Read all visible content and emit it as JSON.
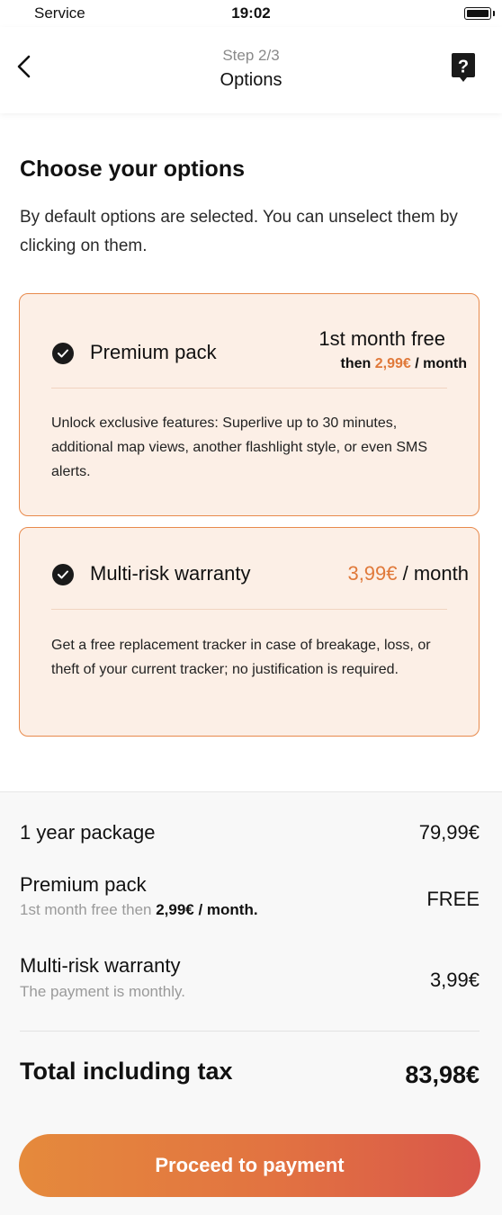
{
  "status_bar": {
    "carrier": "Service",
    "time": "19:02"
  },
  "header": {
    "step": "Step  2/3",
    "title": "Options"
  },
  "intro": {
    "title": "Choose your options",
    "description": "By default options are selected. You can unselect them by clicking on them."
  },
  "options": [
    {
      "name": "Premium pack",
      "selected": true,
      "price_main": "1st month free",
      "price_sub_prefix": "then ",
      "price_sub_amount": "2,99€",
      "price_sub_suffix": " / month",
      "description": "Unlock exclusive features: Superlive up to 30 minutes, additional map views, another flashlight style, or even SMS alerts."
    },
    {
      "name": "Multi-risk warranty",
      "selected": true,
      "price_amount": "3,99€",
      "price_suffix": " / month",
      "description": "Get a free replacement tracker in case of breakage, loss, or theft of your current tracker; no justification is required."
    }
  ],
  "summary": {
    "lines": [
      {
        "label": "1 year package",
        "value": "79,99€"
      },
      {
        "label": "Premium pack",
        "sub_prefix": "1st month free then ",
        "sub_bold": "2,99€ / month.",
        "value": "FREE"
      },
      {
        "label": "Multi-risk warranty",
        "sub": "The payment is monthly.",
        "value": "3,99€"
      }
    ],
    "total_label": "Total including tax",
    "total_value": "83,98€"
  },
  "cta": {
    "label": "Proceed to payment"
  },
  "colors": {
    "accent": "#e0793a",
    "card_bg": "#fcefe6",
    "card_border": "#e88a4c"
  },
  "icons": {
    "back": "chevron-left-icon",
    "help": "question-bubble-icon",
    "check": "check-circle-icon"
  }
}
